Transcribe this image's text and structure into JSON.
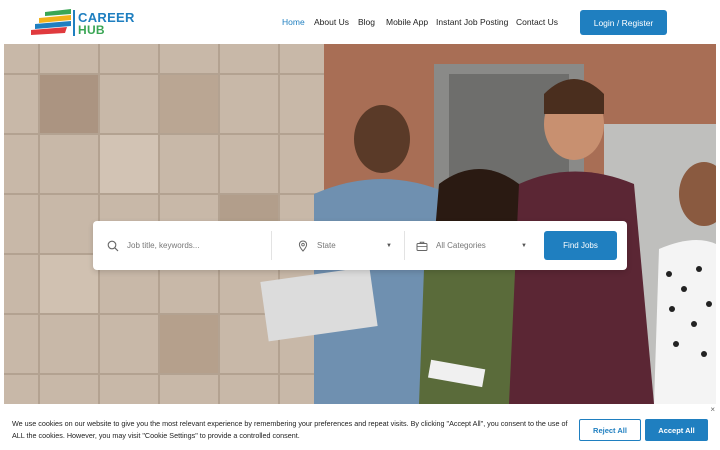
{
  "logo": {
    "line1": "CAREER",
    "line2": "HUB"
  },
  "nav": {
    "items": [
      {
        "label": "Home",
        "active": true
      },
      {
        "label": "About Us"
      },
      {
        "label": "Blog"
      },
      {
        "label": "Mobile App"
      },
      {
        "label": "Instant Job Posting"
      },
      {
        "label": "Contact Us"
      }
    ],
    "login_label": "Login / Register"
  },
  "search": {
    "keywords_placeholder": "Job title, keywords...",
    "state_value": "State",
    "category_value": "All Categories",
    "find_label": "Find Jobs",
    "icons": [
      "search-icon",
      "location-pin-icon",
      "briefcase-icon",
      "caret-down-icon"
    ]
  },
  "cookie": {
    "text": "We use cookies on our website to give you the most relevant experience by remembering your preferences and repeat visits. By clicking \"Accept All\", you consent to the use of ALL the cookies. However, you may visit \"Cookie Settings\" to provide a controlled consent.",
    "reject_label": "Reject All",
    "accept_label": "Accept All",
    "close_symbol": "×"
  },
  "colors": {
    "brand_blue": "#1f7fc0",
    "brand_green": "#3aa655"
  }
}
